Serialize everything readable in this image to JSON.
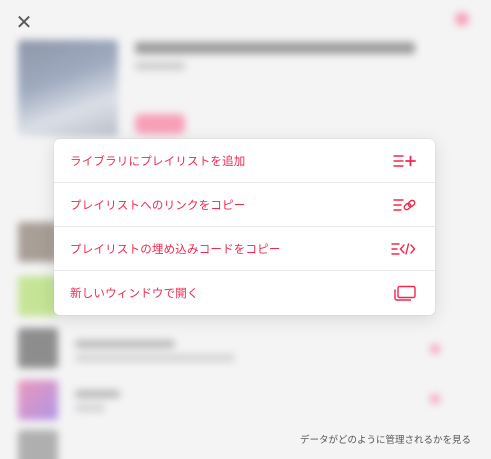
{
  "window": {
    "close_symbol": "✕"
  },
  "menu": {
    "items": [
      {
        "label": "ライブラリにプレイリストを追加",
        "icon": "add-to-list-icon"
      },
      {
        "label": "プレイリストへのリンクをコピー",
        "icon": "copy-link-icon"
      },
      {
        "label": "プレイリストの埋め込みコードをコピー",
        "icon": "embed-code-icon"
      },
      {
        "label": "新しいウィンドウで開く",
        "icon": "new-window-icon"
      }
    ]
  },
  "footer": {
    "privacy_link": "データがどのように管理されるかを見る"
  },
  "colors": {
    "accent": "#f0284e",
    "background": "#f4f4f5"
  }
}
